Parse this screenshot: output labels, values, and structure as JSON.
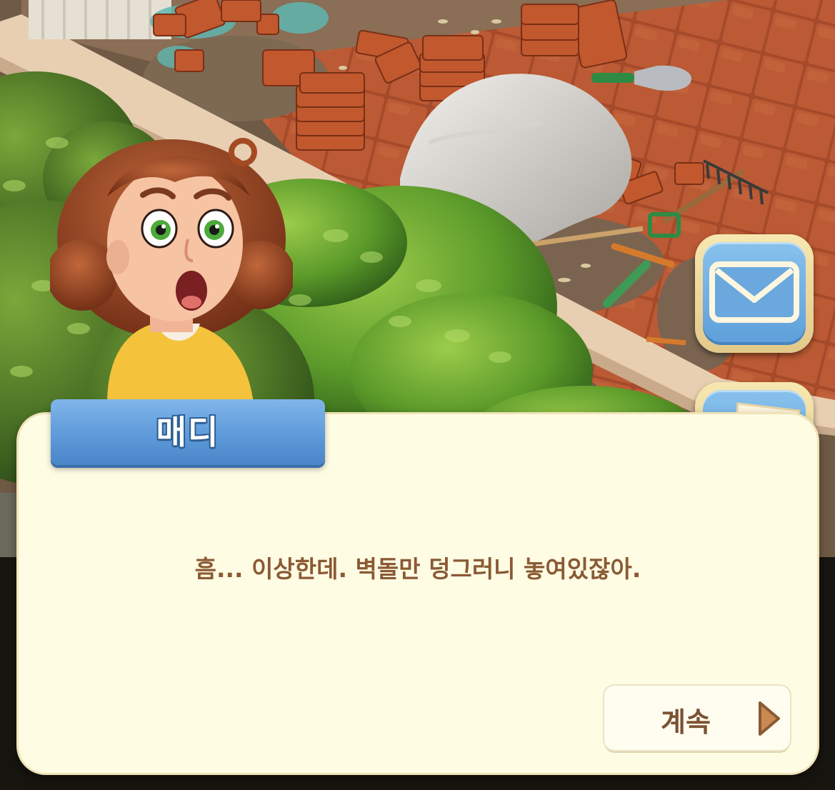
{
  "dialog": {
    "speaker": "매디",
    "message": "흠... 이상한데. 벽돌만 덩그러니 놓여있잖아.",
    "continue_label": "계속"
  },
  "side_buttons": [
    {
      "icon": "envelope-icon"
    },
    {
      "icon": "letter-card-icon"
    }
  ],
  "colors": {
    "panel_bg": "#fffce4",
    "name_tag": "#5c98d8",
    "text_brown": "#8a5a34",
    "button_blue": "#6aa8de",
    "brick": "#b4542e"
  }
}
